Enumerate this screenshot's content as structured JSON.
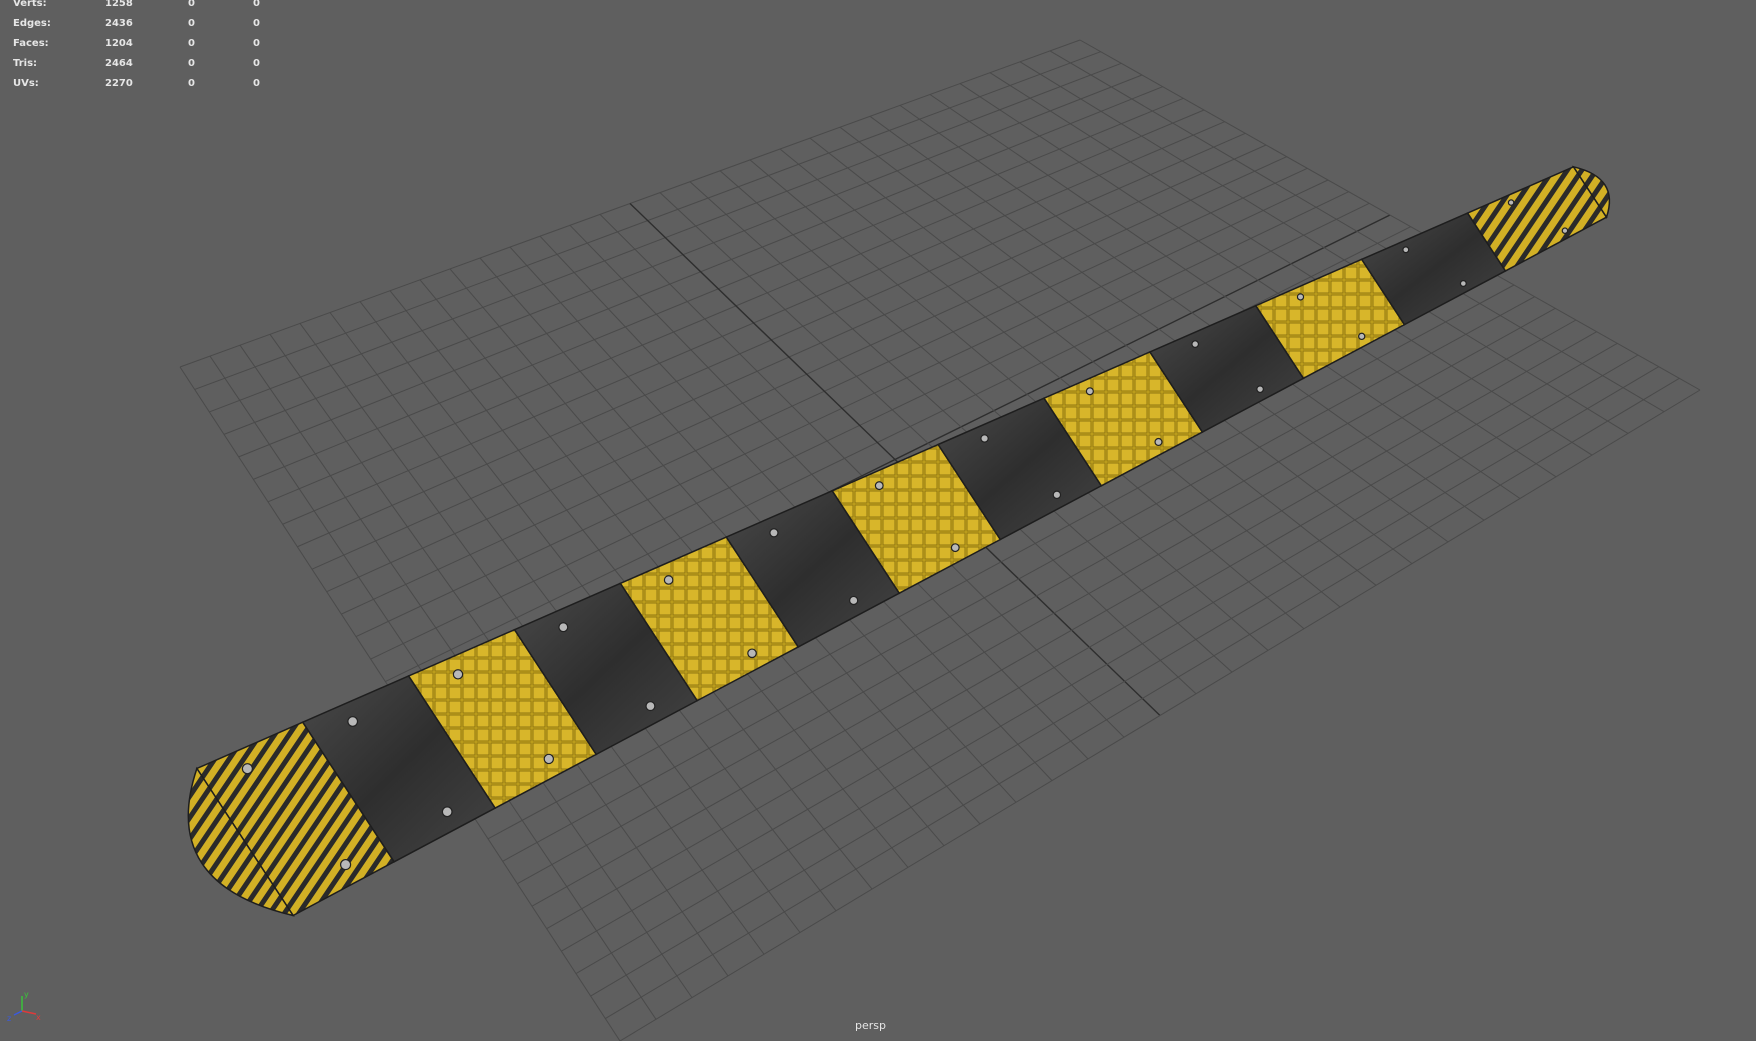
{
  "hud": {
    "rows": [
      {
        "label": "Verts:",
        "v1": "1258",
        "v2": "0",
        "v3": "0"
      },
      {
        "label": "Edges:",
        "v1": "2436",
        "v2": "0",
        "v3": "0"
      },
      {
        "label": "Faces:",
        "v1": "1204",
        "v2": "0",
        "v3": "0"
      },
      {
        "label": "Tris:",
        "v1": "2464",
        "v2": "0",
        "v3": "0"
      },
      {
        "label": "UVs:",
        "v1": "2270",
        "v2": "0",
        "v3": "0"
      }
    ]
  },
  "camera": {
    "label": "persp"
  },
  "axis": {
    "x": "x",
    "y": "y",
    "z": "z"
  },
  "colors": {
    "background": "#5f5f5f",
    "grid": "#474747",
    "yellow": "#c9a91f",
    "black": "#3a3a3a",
    "bolt": "#b8b8b8"
  },
  "object": {
    "segments": [
      "yellow-end",
      "black",
      "yellow",
      "black",
      "yellow",
      "black",
      "yellow",
      "black",
      "yellow",
      "black",
      "yellow",
      "black",
      "yellow-end"
    ]
  }
}
